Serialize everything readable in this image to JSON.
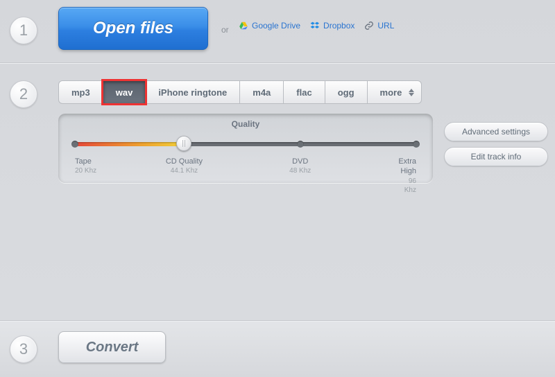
{
  "step1": {
    "number": "1",
    "open_label": "Open files",
    "or_text": "or",
    "links": {
      "gdrive": "Google Drive",
      "dropbox": "Dropbox",
      "url": "URL"
    }
  },
  "step2": {
    "number": "2",
    "formats": [
      "mp3",
      "wav",
      "iPhone ringtone",
      "m4a",
      "flac",
      "ogg",
      "more"
    ],
    "active_index": 1,
    "highlighted_index": 1,
    "quality": {
      "title": "Quality",
      "stops": [
        {
          "name": "Tape",
          "hz": "20 Khz",
          "pos": 0
        },
        {
          "name": "CD Quality",
          "hz": "44.1 Khz",
          "pos": 32
        },
        {
          "name": "DVD",
          "hz": "48 Khz",
          "pos": 66
        },
        {
          "name": "Extra High",
          "hz": "96 Khz",
          "pos": 100
        }
      ],
      "value_pos": 32
    },
    "adv_label": "Advanced settings",
    "edit_label": "Edit track info"
  },
  "step3": {
    "number": "3",
    "convert_label": "Convert"
  }
}
